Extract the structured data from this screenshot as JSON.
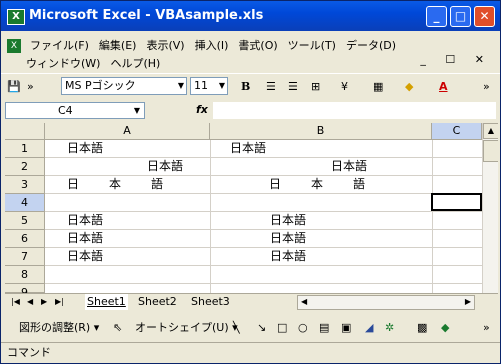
{
  "window": {
    "title": "Microsoft Excel - VBAsample.xls",
    "app_icon": "X"
  },
  "titlebar_buttons": {
    "minimize": "_",
    "maximize": "□",
    "close": "✕"
  },
  "menu": {
    "items_row1": [
      "ファイル(F)",
      "編集(E)",
      "表示(V)",
      "挿入(I)",
      "書式(O)",
      "ツール(T)",
      "データ(D)"
    ],
    "items_row2": [
      "ウィンドウ(W)",
      "ヘルプ(H)"
    ],
    "window_controls": "_ ☐ ✕"
  },
  "toolbar": {
    "font_name": "MS Pゴシック",
    "font_size": "11",
    "bold": "B",
    "more": "»"
  },
  "formula_bar": {
    "name_box": "C4",
    "fx": "fx",
    "formula": ""
  },
  "grid": {
    "columns": [
      "A",
      "B",
      "C"
    ],
    "rows": [
      "1",
      "2",
      "3",
      "4",
      "5",
      "6",
      "7",
      "8",
      "9"
    ],
    "cells": [
      {
        "a": "日本語",
        "b": "日本語"
      },
      {
        "a": "日本語",
        "b": "日本語"
      },
      {
        "a": "日　　本　　語",
        "b": "日　　本　　語"
      },
      {
        "a": "",
        "b": ""
      },
      {
        "a": "日本語",
        "b": "日本語"
      },
      {
        "a": "日本語",
        "b": "日本語"
      },
      {
        "a": "日本語",
        "b": "日本語"
      }
    ],
    "selected_cell": "C4"
  },
  "sheets": {
    "tabs": [
      "Sheet1",
      "Sheet2",
      "Sheet3"
    ],
    "active": "Sheet1"
  },
  "drawing": {
    "adjust": "図形の調整(R)",
    "autoshape": "オートシェイプ(U)"
  },
  "status_bar": {
    "text": "コマンド"
  },
  "colors": {
    "title_blue": "#0a5ae6",
    "chrome": "#ece9d8",
    "excel_green": "#1a7a2e"
  }
}
